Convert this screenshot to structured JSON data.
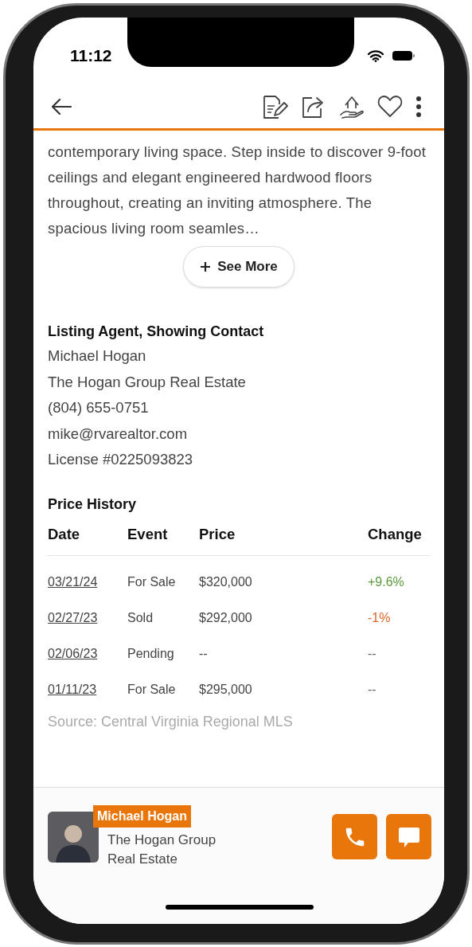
{
  "status_bar": {
    "time": "11:12"
  },
  "description": {
    "text": "contemporary living space. Step inside to discover 9-foot ceilings and elegant engineered hardwood floors throughout, creating an inviting atmosphere. The spacious living room seamles…"
  },
  "see_more_button": {
    "label": "See More"
  },
  "listing_agent": {
    "heading": "Listing Agent, Showing Contact",
    "lines": [
      "Michael Hogan",
      "The Hogan Group Real Estate",
      "(804) 655-0751",
      "mike@rvarealtor.com",
      "License #0225093823"
    ]
  },
  "price_history": {
    "title": "Price History",
    "columns": [
      "Date",
      "Event",
      "Price",
      "Change"
    ],
    "rows": [
      {
        "date": "03/21/24",
        "event": "For Sale",
        "price": "$320,000",
        "change": "+9.6%",
        "color": "#5a9a3c"
      },
      {
        "date": "02/27/23",
        "event": "Sold",
        "price": "$292,000",
        "change": "-1%",
        "color": "#e0652a"
      },
      {
        "date": "02/06/23",
        "event": "Pending",
        "price": "--",
        "change": "--",
        "color": "#666666"
      },
      {
        "date": "01/11/23",
        "event": "For Sale",
        "price": "$295,000",
        "change": "--",
        "color": "#666666"
      }
    ],
    "source": "Source: Central Virginia Regional MLS"
  },
  "agent_bar": {
    "name": "Michael Hogan",
    "company": "The Hogan Group Real Estate"
  }
}
